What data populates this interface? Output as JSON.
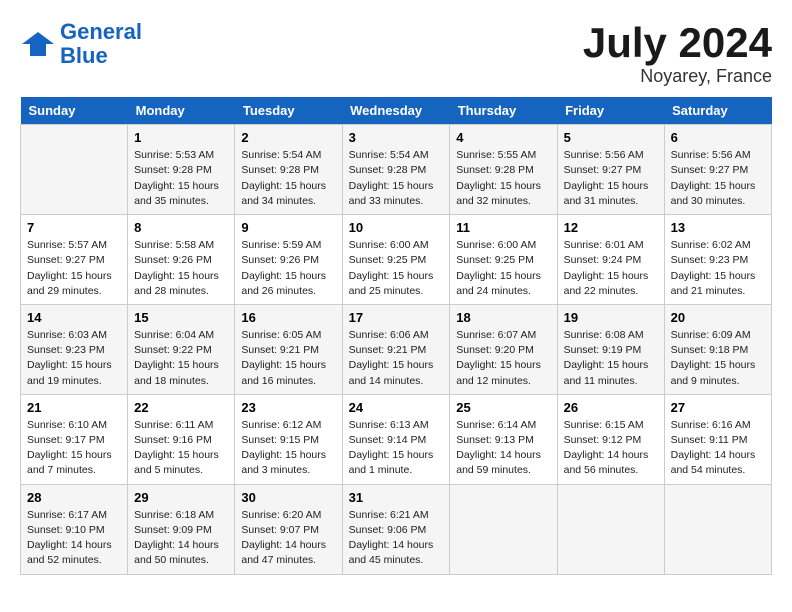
{
  "header": {
    "logo_line1": "General",
    "logo_line2": "Blue",
    "title": "July 2024",
    "subtitle": "Noyarey, France"
  },
  "columns": [
    "Sunday",
    "Monday",
    "Tuesday",
    "Wednesday",
    "Thursday",
    "Friday",
    "Saturday"
  ],
  "weeks": [
    [
      {
        "day": "",
        "content": ""
      },
      {
        "day": "1",
        "content": "Sunrise: 5:53 AM\nSunset: 9:28 PM\nDaylight: 15 hours\nand 35 minutes."
      },
      {
        "day": "2",
        "content": "Sunrise: 5:54 AM\nSunset: 9:28 PM\nDaylight: 15 hours\nand 34 minutes."
      },
      {
        "day": "3",
        "content": "Sunrise: 5:54 AM\nSunset: 9:28 PM\nDaylight: 15 hours\nand 33 minutes."
      },
      {
        "day": "4",
        "content": "Sunrise: 5:55 AM\nSunset: 9:28 PM\nDaylight: 15 hours\nand 32 minutes."
      },
      {
        "day": "5",
        "content": "Sunrise: 5:56 AM\nSunset: 9:27 PM\nDaylight: 15 hours\nand 31 minutes."
      },
      {
        "day": "6",
        "content": "Sunrise: 5:56 AM\nSunset: 9:27 PM\nDaylight: 15 hours\nand 30 minutes."
      }
    ],
    [
      {
        "day": "7",
        "content": "Sunrise: 5:57 AM\nSunset: 9:27 PM\nDaylight: 15 hours\nand 29 minutes."
      },
      {
        "day": "8",
        "content": "Sunrise: 5:58 AM\nSunset: 9:26 PM\nDaylight: 15 hours\nand 28 minutes."
      },
      {
        "day": "9",
        "content": "Sunrise: 5:59 AM\nSunset: 9:26 PM\nDaylight: 15 hours\nand 26 minutes."
      },
      {
        "day": "10",
        "content": "Sunrise: 6:00 AM\nSunset: 9:25 PM\nDaylight: 15 hours\nand 25 minutes."
      },
      {
        "day": "11",
        "content": "Sunrise: 6:00 AM\nSunset: 9:25 PM\nDaylight: 15 hours\nand 24 minutes."
      },
      {
        "day": "12",
        "content": "Sunrise: 6:01 AM\nSunset: 9:24 PM\nDaylight: 15 hours\nand 22 minutes."
      },
      {
        "day": "13",
        "content": "Sunrise: 6:02 AM\nSunset: 9:23 PM\nDaylight: 15 hours\nand 21 minutes."
      }
    ],
    [
      {
        "day": "14",
        "content": "Sunrise: 6:03 AM\nSunset: 9:23 PM\nDaylight: 15 hours\nand 19 minutes."
      },
      {
        "day": "15",
        "content": "Sunrise: 6:04 AM\nSunset: 9:22 PM\nDaylight: 15 hours\nand 18 minutes."
      },
      {
        "day": "16",
        "content": "Sunrise: 6:05 AM\nSunset: 9:21 PM\nDaylight: 15 hours\nand 16 minutes."
      },
      {
        "day": "17",
        "content": "Sunrise: 6:06 AM\nSunset: 9:21 PM\nDaylight: 15 hours\nand 14 minutes."
      },
      {
        "day": "18",
        "content": "Sunrise: 6:07 AM\nSunset: 9:20 PM\nDaylight: 15 hours\nand 12 minutes."
      },
      {
        "day": "19",
        "content": "Sunrise: 6:08 AM\nSunset: 9:19 PM\nDaylight: 15 hours\nand 11 minutes."
      },
      {
        "day": "20",
        "content": "Sunrise: 6:09 AM\nSunset: 9:18 PM\nDaylight: 15 hours\nand 9 minutes."
      }
    ],
    [
      {
        "day": "21",
        "content": "Sunrise: 6:10 AM\nSunset: 9:17 PM\nDaylight: 15 hours\nand 7 minutes."
      },
      {
        "day": "22",
        "content": "Sunrise: 6:11 AM\nSunset: 9:16 PM\nDaylight: 15 hours\nand 5 minutes."
      },
      {
        "day": "23",
        "content": "Sunrise: 6:12 AM\nSunset: 9:15 PM\nDaylight: 15 hours\nand 3 minutes."
      },
      {
        "day": "24",
        "content": "Sunrise: 6:13 AM\nSunset: 9:14 PM\nDaylight: 15 hours\nand 1 minute."
      },
      {
        "day": "25",
        "content": "Sunrise: 6:14 AM\nSunset: 9:13 PM\nDaylight: 14 hours\nand 59 minutes."
      },
      {
        "day": "26",
        "content": "Sunrise: 6:15 AM\nSunset: 9:12 PM\nDaylight: 14 hours\nand 56 minutes."
      },
      {
        "day": "27",
        "content": "Sunrise: 6:16 AM\nSunset: 9:11 PM\nDaylight: 14 hours\nand 54 minutes."
      }
    ],
    [
      {
        "day": "28",
        "content": "Sunrise: 6:17 AM\nSunset: 9:10 PM\nDaylight: 14 hours\nand 52 minutes."
      },
      {
        "day": "29",
        "content": "Sunrise: 6:18 AM\nSunset: 9:09 PM\nDaylight: 14 hours\nand 50 minutes."
      },
      {
        "day": "30",
        "content": "Sunrise: 6:20 AM\nSunset: 9:07 PM\nDaylight: 14 hours\nand 47 minutes."
      },
      {
        "day": "31",
        "content": "Sunrise: 6:21 AM\nSunset: 9:06 PM\nDaylight: 14 hours\nand 45 minutes."
      },
      {
        "day": "",
        "content": ""
      },
      {
        "day": "",
        "content": ""
      },
      {
        "day": "",
        "content": ""
      }
    ]
  ]
}
